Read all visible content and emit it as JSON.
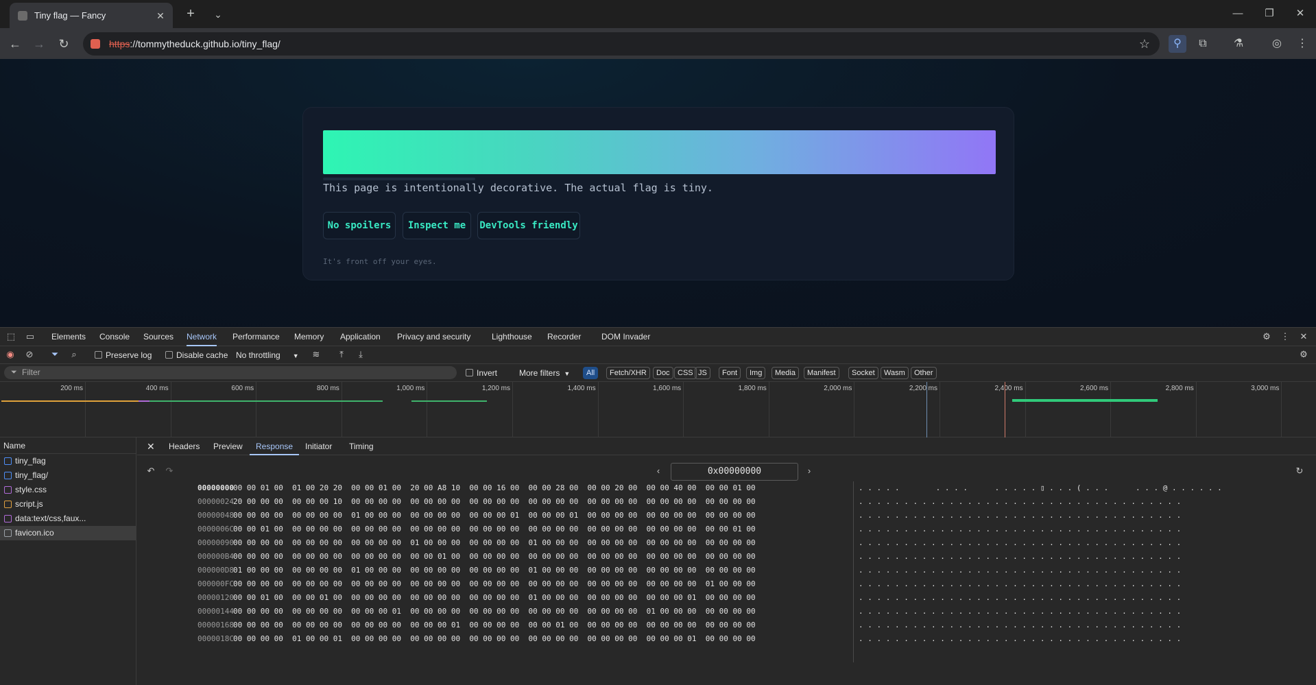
{
  "browser": {
    "tab_title": "Tiny flag — Fancy",
    "new_tab": "+",
    "url_scheme": "https",
    "url_rest": "://tommytheduck.github.io/tiny_flag/"
  },
  "page": {
    "tagline": "This page is intentionally decorative. The actual flag is tiny.",
    "chips": [
      "No spoilers",
      "Inspect me",
      "DevTools friendly"
    ],
    "footnote": "It's front off your eyes."
  },
  "devtools": {
    "tabs": [
      "Elements",
      "Console",
      "Sources",
      "Network",
      "Performance",
      "Memory",
      "Application",
      "Privacy and security",
      "Lighthouse",
      "Recorder",
      "DOM Invader"
    ],
    "active_tab": "Network",
    "toolbar": {
      "preserve_log": "Preserve log",
      "disable_cache": "Disable cache",
      "throttling": "No throttling"
    },
    "filter": {
      "placeholder": "Filter",
      "invert": "Invert",
      "more_filters": "More filters",
      "types": [
        "All",
        "Fetch/XHR",
        "Doc",
        "CSS",
        "JS",
        "Font",
        "Img",
        "Media",
        "Manifest",
        "Socket",
        "Wasm",
        "Other"
      ]
    },
    "timeline_ticks": [
      "200 ms",
      "400 ms",
      "600 ms",
      "800 ms",
      "1,000 ms",
      "1,200 ms",
      "1,400 ms",
      "1,600 ms",
      "1,800 ms",
      "2,000 ms",
      "2,200 ms",
      "2,400 ms",
      "2,600 ms",
      "2,800 ms",
      "3,000 ms"
    ],
    "name_header": "Name",
    "requests": [
      {
        "name": "tiny_flag",
        "icon_color": "#4e8ef7"
      },
      {
        "name": "tiny_flag/",
        "icon_color": "#4e8ef7"
      },
      {
        "name": "style.css",
        "icon_color": "#b06bd8"
      },
      {
        "name": "script.js",
        "icon_color": "#e0a040"
      },
      {
        "name": "data:text/css,faux...",
        "icon_color": "#b06bd8"
      },
      {
        "name": "favicon.ico",
        "icon_color": "#9aa0a6"
      }
    ],
    "detail_tabs": [
      "Headers",
      "Preview",
      "Response",
      "Initiator",
      "Timing"
    ],
    "active_detail": "Response",
    "address": "0x00000000",
    "hex_rows": [
      {
        "offset": "00000000",
        "bytes": "00 00 01 00  01 00 20 20  00 00 01 00  20 00 A8 10  00 00 16 00  00 00 28 00  00 00 20 00  00 00 40 00  00 00 01 00",
        "ascii": ". . . . .        . . . .      . . . . . ▯ . . . ( . . .      . . . @ . . . . . ."
      },
      {
        "offset": "00000024",
        "bytes": "20 00 00 00  00 00 00 10  00 00 00 00  00 00 00 00  00 00 00 00  00 00 00 00  00 00 00 00  00 00 00 00  00 00 00 00",
        "ascii": ". . . . . . . . . . . . . . . . . . . . . . . . . . . . . . . . . . . ."
      },
      {
        "offset": "00000048",
        "bytes": "00 00 00 00  00 00 00 00  01 00 00 00  00 00 00 00  00 00 00 01  00 00 00 01  00 00 00 00  00 00 00 00  00 00 00 00",
        "ascii": ". . . . . . . . . . . . . . . . . . . . . . . . . . . . . . . . . . . ."
      },
      {
        "offset": "0000006C",
        "bytes": "00 00 01 00  00 00 00 00  00 00 00 00  00 00 00 00  00 00 00 00  00 00 00 00  00 00 00 00  00 00 00 00  00 00 01 00",
        "ascii": ". . . . . . . . . . . . . . . . . . . . . . . . . . . . . . . . . . . ."
      },
      {
        "offset": "00000090",
        "bytes": "00 00 00 00  00 00 00 00  00 00 00 00  01 00 00 00  00 00 00 00  01 00 00 00  00 00 00 00  00 00 00 00  00 00 00 00",
        "ascii": ". . . . . . . . . . . . . . . . . . . . . . . . . . . . . . . . . . . ."
      },
      {
        "offset": "000000B4",
        "bytes": "00 00 00 00  00 00 00 00  00 00 00 00  00 00 01 00  00 00 00 00  00 00 00 00  00 00 00 00  00 00 00 00  00 00 00 00",
        "ascii": ". . . . . . . . . . . . . . . . . . . . . . . . . . . . . . . . . . . ."
      },
      {
        "offset": "000000D8",
        "bytes": "01 00 00 00  00 00 00 00  01 00 00 00  00 00 00 00  00 00 00 00  01 00 00 00  00 00 00 00  00 00 00 00  00 00 00 00",
        "ascii": ". . . . . . . . . . . . . . . . . . . . . . . . . . . . . . . . . . . ."
      },
      {
        "offset": "000000FC",
        "bytes": "00 00 00 00  00 00 00 00  00 00 00 00  00 00 00 00  00 00 00 00  00 00 00 00  00 00 00 00  00 00 00 00  01 00 00 00",
        "ascii": ". . . . . . . . . . . . . . . . . . . . . . . . . . . . . . . . . . . ."
      },
      {
        "offset": "00000120",
        "bytes": "00 00 01 00  00 00 01 00  00 00 00 00  00 00 00 00  00 00 00 00  01 00 00 00  00 00 00 00  00 00 00 01  00 00 00 00",
        "ascii": ". . . . . . . . . . . . . . . . . . . . . . . . . . . . . . . . . . . ."
      },
      {
        "offset": "00000144",
        "bytes": "00 00 00 00  00 00 00 00  00 00 00 01  00 00 00 00  00 00 00 00  00 00 00 00  00 00 00 00  01 00 00 00  00 00 00 00",
        "ascii": ". . . . . . . . . . . . . . . . . . . . . . . . . . . . . . . . . . . ."
      },
      {
        "offset": "00000168",
        "bytes": "00 00 00 00  00 00 00 00  00 00 00 00  00 00 00 01  00 00 00 00  00 00 01 00  00 00 00 00  00 00 00 00  00 00 00 00",
        "ascii": ". . . . . . . . . . . . . . . . . . . . . . . . . . . . . . . . . . . ."
      },
      {
        "offset": "0000018C",
        "bytes": "00 00 00 00  01 00 00 01  00 00 00 00  00 00 00 00  00 00 00 00  00 00 00 00  00 00 00 00  00 00 00 01  00 00 00 00",
        "ascii": ". . . . . . . . . . . . . . . . . . . . . . . . . . . . . . . . . . . ."
      }
    ]
  }
}
